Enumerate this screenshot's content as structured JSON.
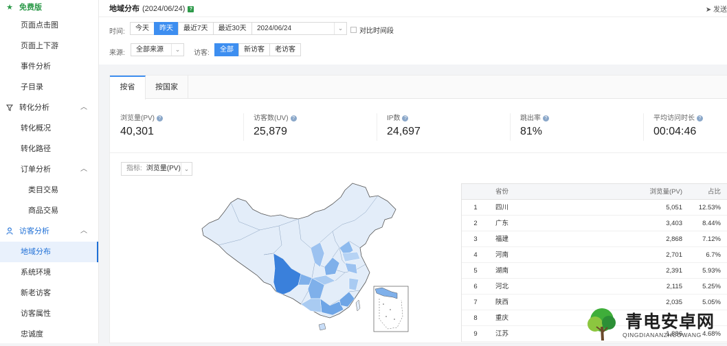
{
  "sidebar": {
    "top_item": "免费版",
    "items": [
      {
        "label": "页面点击图"
      },
      {
        "label": "页面上下游"
      },
      {
        "label": "事件分析"
      },
      {
        "label": "子目录"
      },
      {
        "label": "转化分析"
      },
      {
        "label": "转化概况"
      },
      {
        "label": "转化路径"
      },
      {
        "label": "订单分析"
      },
      {
        "label": "类目交易"
      },
      {
        "label": "商品交易"
      },
      {
        "label": "访客分析"
      },
      {
        "label": "地域分布"
      },
      {
        "label": "系统环境"
      },
      {
        "label": "新老访客"
      },
      {
        "label": "访客属性"
      },
      {
        "label": "忠诚度"
      }
    ]
  },
  "header": {
    "title": "地域分布",
    "date": "(2024/06/24)",
    "send_label": "发送",
    "time_label": "时间:",
    "time_buttons": [
      "今天",
      "昨天",
      "最近7天",
      "最近30天"
    ],
    "time_selected": "昨天",
    "date_value": "2024/06/24",
    "compare_label": "对比时间段",
    "source_label": "来源:",
    "source_value": "全部来源",
    "visitor_label": "访客:",
    "visitor_buttons": [
      "全部",
      "新访客",
      "老访客"
    ],
    "visitor_selected": "全部"
  },
  "tabs": [
    "按省",
    "按国家"
  ],
  "active_tab": "按省",
  "metrics": [
    {
      "label": "浏览量(PV)",
      "value": "40,301"
    },
    {
      "label": "访客数(UV)",
      "value": "25,879"
    },
    {
      "label": "IP数",
      "value": "24,697"
    },
    {
      "label": "跳出率",
      "value": "81%"
    },
    {
      "label": "平均访问时长",
      "value": "00:04:46"
    }
  ],
  "indicator": {
    "key": "指标:",
    "value": "浏览量(PV)"
  },
  "table": {
    "headers": {
      "province": "省份",
      "pv": "浏览量(PV)",
      "pct": "占比"
    },
    "rows": [
      {
        "rank": "1",
        "province": "四川",
        "pv": "5,051",
        "pct": "12.53%"
      },
      {
        "rank": "2",
        "province": "广东",
        "pv": "3,403",
        "pct": "8.44%"
      },
      {
        "rank": "3",
        "province": "福建",
        "pv": "2,868",
        "pct": "7.12%"
      },
      {
        "rank": "4",
        "province": "河南",
        "pv": "2,701",
        "pct": "6.7%"
      },
      {
        "rank": "5",
        "province": "湖南",
        "pv": "2,391",
        "pct": "5.93%"
      },
      {
        "rank": "6",
        "province": "河北",
        "pv": "2,115",
        "pct": "5.25%"
      },
      {
        "rank": "7",
        "province": "陕西",
        "pv": "2,035",
        "pct": "5.05%"
      },
      {
        "rank": "8",
        "province": "重庆",
        "pv": "",
        "pct": ""
      },
      {
        "rank": "9",
        "province": "江苏",
        "pv": "1,886",
        "pct": "4.68%"
      }
    ]
  },
  "watermark": {
    "title": "青电安卓网",
    "subtitle": "QINGDIANANZHUOWANG"
  },
  "colors": {
    "accent": "#3d8ef0",
    "map_dark": "#3a80db",
    "map_mid": "#7fb0ea",
    "map_light": "#e3edf9",
    "green": "#2d9a4a"
  }
}
